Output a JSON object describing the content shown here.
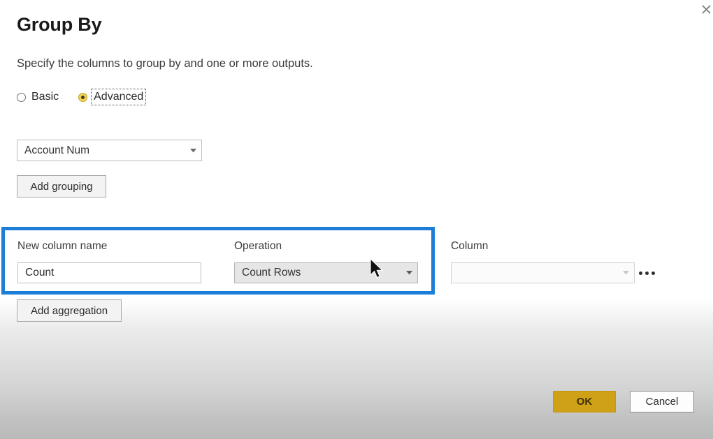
{
  "dialog": {
    "title": "Group By",
    "subtitle": "Specify the columns to group by and one or more outputs.",
    "close_icon": "close-icon"
  },
  "mode": {
    "options": [
      {
        "label": "Basic",
        "selected": false
      },
      {
        "label": "Advanced",
        "selected": true,
        "focused": true
      }
    ]
  },
  "grouping": {
    "column_value": "Account Num",
    "add_button_label": "Add grouping"
  },
  "aggregation": {
    "labels": {
      "new_column_name": "New column name",
      "operation": "Operation",
      "column": "Column"
    },
    "new_column_name_value": "Count",
    "new_column_name_placeholder": "",
    "operation_value": "Count Rows",
    "column_value": "",
    "more_options_label": "...",
    "add_button_label": "Add aggregation"
  },
  "footer": {
    "ok_label": "OK",
    "cancel_label": "Cancel"
  },
  "colors": {
    "highlight": "#1c7ed6",
    "primary_button": "#cfa117",
    "radio_selected": "#f2d25a"
  }
}
